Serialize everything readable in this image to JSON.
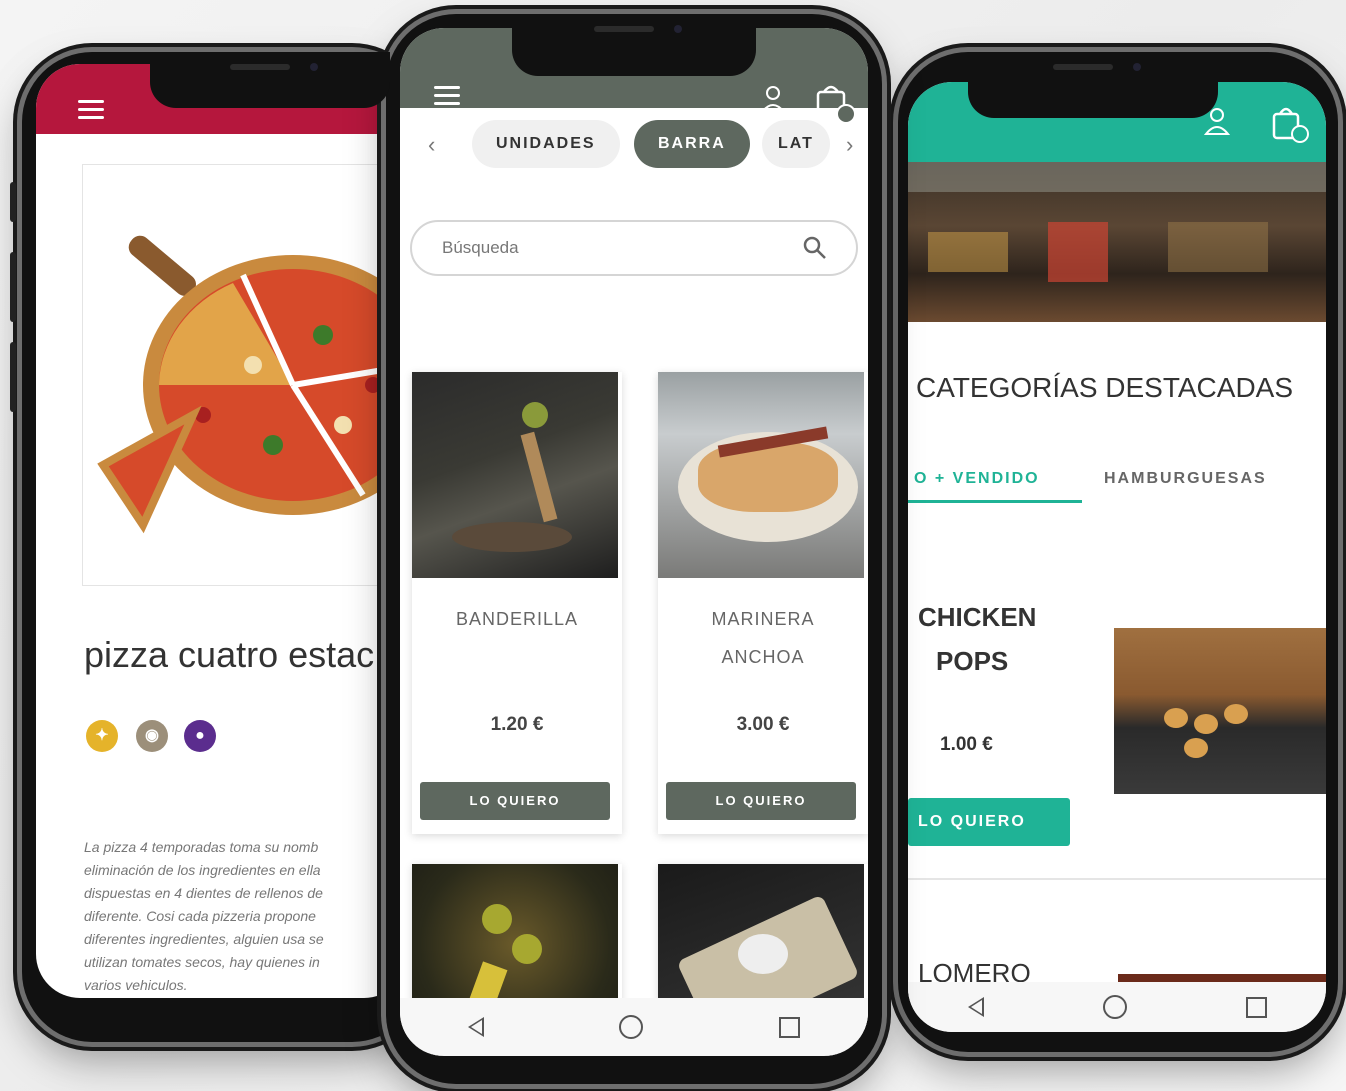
{
  "phone_left": {
    "product_title": "pizza cuatro estac",
    "allergens": [
      {
        "name": "gluten-icon",
        "color": "#e5b32a"
      },
      {
        "name": "lactose-icon",
        "color": "#9c8f7a"
      },
      {
        "name": "egg-icon",
        "color": "#5b2d8e"
      }
    ],
    "description_lines": [
      "La pizza 4 temporadas toma su nomb",
      "eliminación de los ingredientes en ella",
      "dispuestas en 4 dientes de rellenos de",
      "diferente. Cosi cada pizzeria propone",
      "diferentes ingredientes, alguien usa se",
      "utilizan tomates secos, hay quienes in",
      "varios vehiculos."
    ],
    "header_color": "#b5173d"
  },
  "phone_center": {
    "tabs": [
      "UNIDADES",
      "BARRA",
      "LAT"
    ],
    "active_tab": "BARRA",
    "search_placeholder": "Búsqueda",
    "products": [
      {
        "name": "BANDERILLA",
        "price": "1.20 €",
        "button": "LO QUIERO"
      },
      {
        "name": "MARINERA ANCHOA",
        "price": "3.00 €",
        "button": "LO QUIERO"
      }
    ],
    "header_color": "#5e685f"
  },
  "phone_right": {
    "section_title": "CATEGORÍAS DESTACADAS",
    "tabs": [
      "O + VENDIDO",
      "HAMBURGUESAS"
    ],
    "items": [
      {
        "name_line1": "CHICKEN",
        "name_line2": "POPS",
        "price": "1.00 €",
        "button": "LO QUIERO"
      },
      {
        "name_line1": "LOMERO"
      }
    ],
    "header_color": "#1fb396"
  }
}
